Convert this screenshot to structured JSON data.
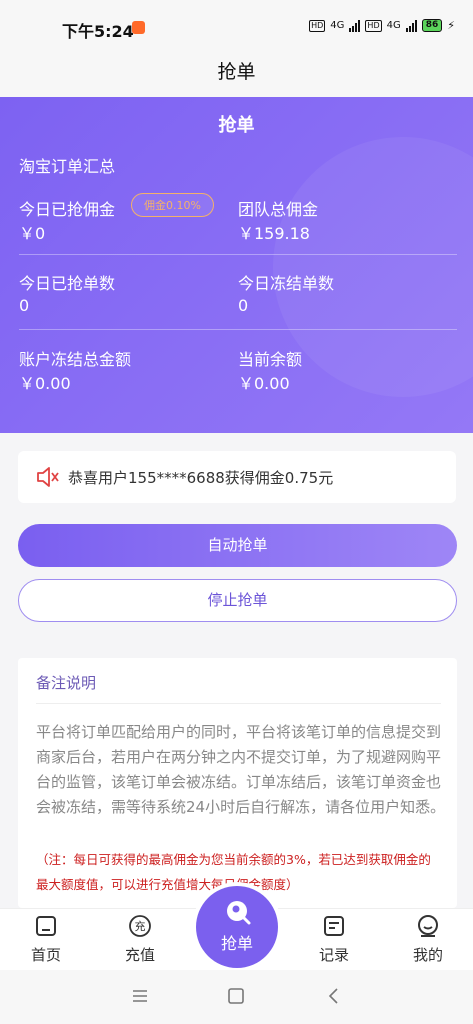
{
  "status": {
    "time": "下午5:24",
    "hd1": "HD",
    "net1": "4G",
    "hd2": "HD",
    "net2": "4G",
    "battery": "86"
  },
  "nav": {
    "title": "抢单"
  },
  "hero": {
    "title": "抢单",
    "subtitle": "淘宝订单汇总",
    "stats": {
      "today_commission_label": "今日已抢佣金",
      "today_commission_value": "￥0",
      "rate_badge": "佣金0.10%",
      "team_commission_label": "团队总佣金",
      "team_commission_value": "￥159.18",
      "today_orders_label": "今日已抢单数",
      "today_orders_value": "0",
      "today_frozen_label": "今日冻结单数",
      "today_frozen_value": "0",
      "frozen_total_label": "账户冻结总金额",
      "frozen_total_value": "￥0.00",
      "balance_label": "当前余额",
      "balance_value": "￥0.00"
    }
  },
  "notice": {
    "icon": "speaker-icon",
    "text": "恭喜用户155****6688获得佣金0.75元"
  },
  "buttons": {
    "auto": "自动抢单",
    "stop": "停止抢单"
  },
  "remarks": {
    "title": "备注说明",
    "body": "平台将订单匹配给用户的同时，平台将该笔订单的信息提交到商家后台，若用户在两分钟之内不提交订单，为了规避网购平台的监管，该笔订单会被冻结。订单冻结后，该笔订单资金也会被冻结，需等待系统24小时后自行解冻，请各位用户知悉。",
    "note": "（注：每日可获得的最高佣金为您当前余额的3%，若已达到获取佣金的最大额度值，可以进行充值增大每日佣金额度）"
  },
  "tabbar": {
    "home": "首页",
    "recharge": "充值",
    "grab": "抢单",
    "records": "记录",
    "mine": "我的"
  },
  "colors": {
    "primary": "#7b60ee",
    "accent_orange": "#f3b16a",
    "note_red": "#cc1f1f"
  }
}
